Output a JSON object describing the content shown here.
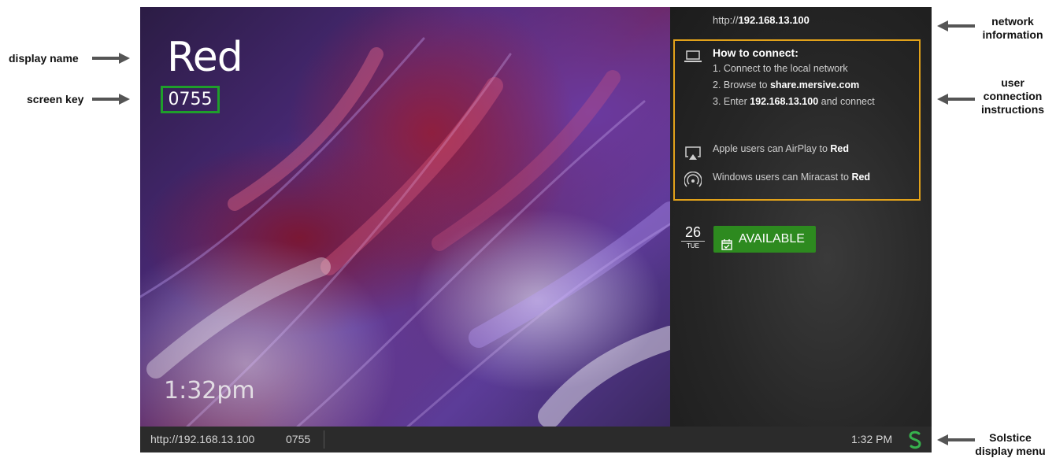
{
  "annotations": {
    "display_name": "display name",
    "screen_key": "screen key",
    "network_information_1": "network",
    "network_information_2": "information",
    "user_connection_1": "user",
    "user_connection_2": "connection",
    "user_connection_3": "instructions",
    "solstice_menu_1": "Solstice",
    "solstice_menu_2": "display menu"
  },
  "wallpaper": {
    "display_name": "Red",
    "screen_key": "0755",
    "time": "1:32pm"
  },
  "panel": {
    "network_prefix": "http://",
    "network_ip": "192.168.13.100",
    "how_to_title": "How to connect:",
    "step1": "1. Connect to the local network",
    "step2_prefix": "2. Browse to ",
    "step2_url": "share.mersive.com",
    "step3_prefix": "3. Enter ",
    "step3_ip": "192.168.13.100",
    "step3_suffix": " and connect",
    "airplay_prefix": "Apple users can AirPlay to ",
    "airplay_name": "Red",
    "miracast_prefix": "Windows users can Miracast to ",
    "miracast_name": "Red",
    "date_day": "26",
    "date_dow": "TUE",
    "status": "AVAILABLE"
  },
  "bottom_bar": {
    "url": "http://192.168.13.100",
    "key": "0755",
    "time": "1:32 PM"
  },
  "colors": {
    "screen_key_border": "#1f9e2b",
    "connect_box_border": "#e2a21a",
    "available_bg": "#2d8a1f",
    "solstice_logo": "#37b24d"
  },
  "icons": [
    "laptop-icon",
    "airplay-icon",
    "miracast-icon",
    "calendar-check-icon",
    "solstice-logo-icon",
    "arrow-icon"
  ]
}
